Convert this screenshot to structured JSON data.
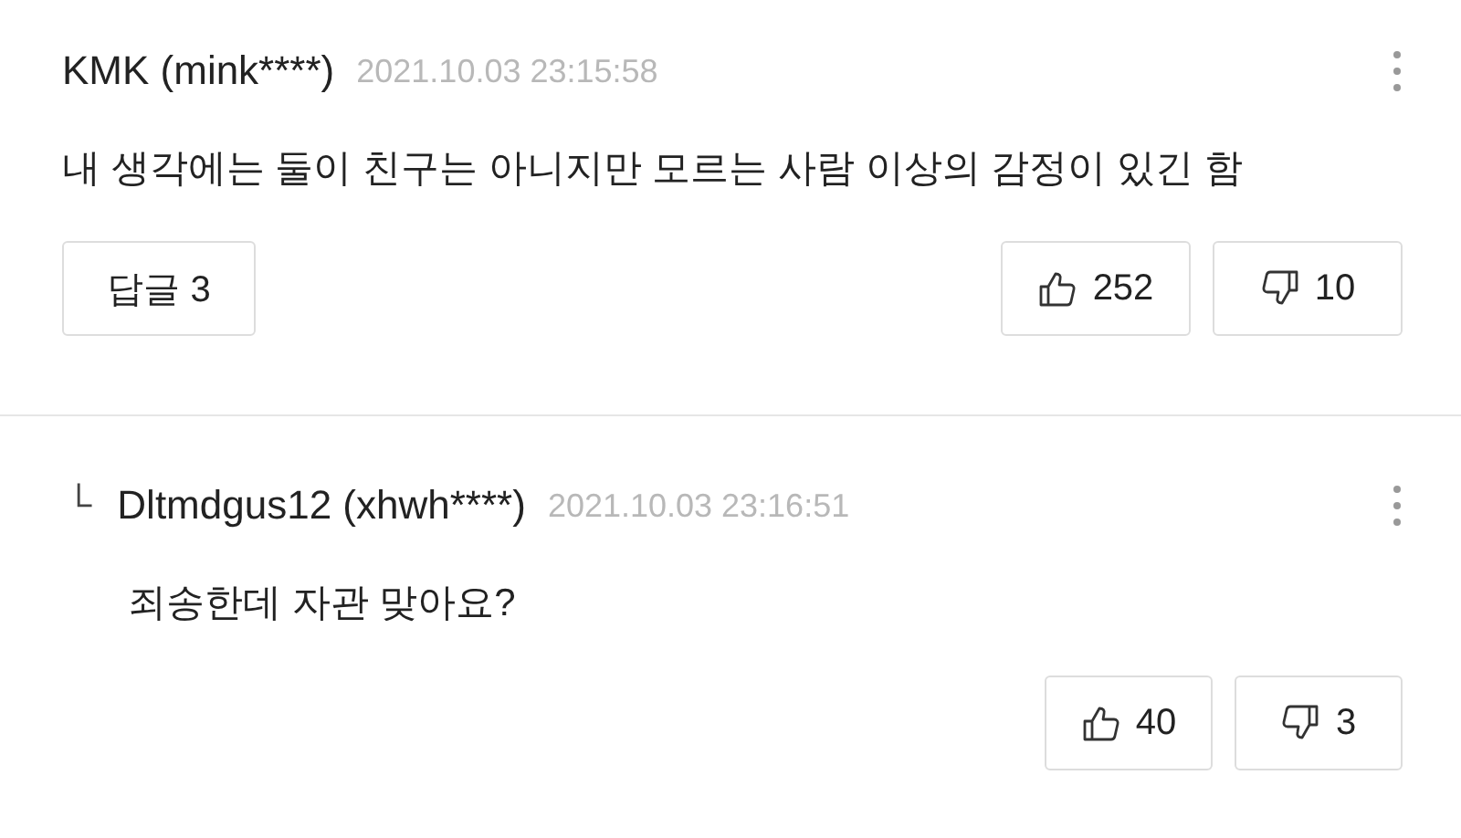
{
  "comments": [
    {
      "kind": "comment",
      "author": "KMK (mink****)",
      "time": "2021.10.03 23:15:58",
      "text": "내 생각에는 둘이 친구는 아니지만 모르는 사람 이상의 감정이 있긴 함",
      "reply_button": "답글 3",
      "likes": "252",
      "dislikes": "10"
    },
    {
      "kind": "reply",
      "marker": "└",
      "author": "Dltmdgus12 (xhwh****)",
      "time": "2021.10.03 23:16:51",
      "text": "죄송한데 자관 맞아요?",
      "likes": "40",
      "dislikes": "3"
    }
  ]
}
